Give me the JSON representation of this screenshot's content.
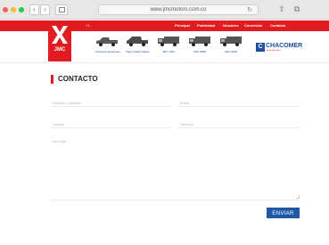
{
  "browser": {
    "url": "www.jmcmotors.com.co",
    "reload_glyph": "↻",
    "back_glyph": "‹",
    "forward_glyph": "›",
    "share_glyph": "⇧",
    "tabs_glyph": "⧉"
  },
  "header": {
    "brand_color": "#e11b1f",
    "logo_text": "JMC",
    "social": "f  t",
    "top_nav": [
      "Principal",
      "Publicidad",
      "Nosotros",
      "Concesión",
      "Contacto"
    ],
    "vehicles": [
      {
        "label": "Carnivore Emisiones"
      },
      {
        "label": "Vigus Doble Cabina"
      },
      {
        "label": "JMC 1040"
      },
      {
        "label": "JMC N800"
      },
      {
        "label": "JMC N900"
      }
    ],
    "distributor": {
      "mark": "C",
      "name": "CHACOMER",
      "tagline": "distribuidor oficial"
    }
  },
  "contact": {
    "title": "CONTACTO",
    "fields": [
      {
        "placeholder": "Nombre y apellido"
      },
      {
        "placeholder": "Email"
      },
      {
        "placeholder": "Ciudad"
      },
      {
        "placeholder": "Teléfono"
      }
    ],
    "message_placeholder": "Mensaje",
    "submit_label": "ENVIAR",
    "accent_color": "#1e58a8"
  }
}
